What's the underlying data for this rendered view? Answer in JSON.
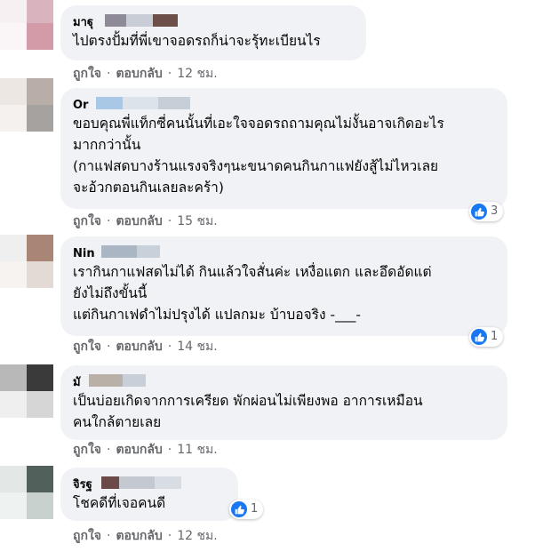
{
  "comments": [
    {
      "author": "มาฐุ",
      "text": "ไปตรงปั้มที่พี่เขาจอดรถก็น่าจะรุ้ทะเบียนไร",
      "like_label": "ถูกใจ",
      "reply_label": "ตอบกลับ",
      "time": "12 ชม."
    },
    {
      "author": "Or",
      "text": "ขอบคุณพี่แท็กซี่คนนั้นที่เอะใจจอดรถถามคุณไม่งั้นอาจเกิดอะไร\nมากกว่านั้น\n(กาแฟสดบางร้านแรงจริงๆนะขนาดคนกินกาแฟยังสู้ไม่ไหวเลย\nจะอ้วกตอนกินเลยละคร้า)",
      "like_label": "ถูกใจ",
      "reply_label": "ตอบกลับ",
      "time": "15 ชม.",
      "reaction_count": "3"
    },
    {
      "author": "Nin",
      "text": "เรากินกาแฟสดไม่ได้ กินแล้วใจสั่นค่ะ เหงื่อแตก และอึดอัดแต่\nยังไม่ถึงขั้นนี้\nแต่กินกาเฟดำไม่ปรุงได้ แปลกมะ บ้าบอจริง -___-",
      "like_label": "ถูกใจ",
      "reply_label": "ตอบกลับ",
      "time": "14 ชม.",
      "reaction_count": "1"
    },
    {
      "author": "มั",
      "text": "เป็นบ่อยเกิดจากการเครียด พักผ่อนไม่เพียงพอ อาการเหมือน\nคนใกล้ตายเลย",
      "like_label": "ถูกใจ",
      "reply_label": "ตอบกลับ",
      "time": "11 ชม."
    },
    {
      "author": "จิรฐ",
      "text": "โชคดีที่เจอคนดี",
      "like_label": "ถูกใจ",
      "reply_label": "ตอบกลับ",
      "time": "12 ชม.",
      "reaction_count": "1"
    }
  ],
  "colors": {
    "bubble": "#f0f2f5",
    "meta_text": "#65676b",
    "like_blue": "#1877f2"
  }
}
